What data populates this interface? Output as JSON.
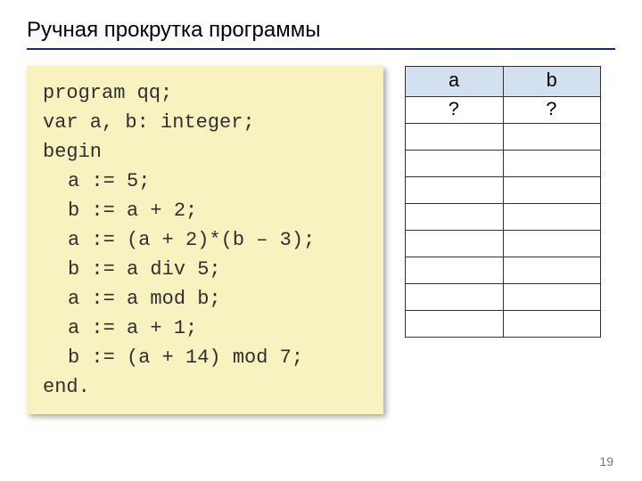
{
  "title": "Ручная прокрутка программы",
  "code": {
    "lines": [
      {
        "text": "program qq;",
        "indent": false
      },
      {
        "text": "var a, b: integer;",
        "indent": false
      },
      {
        "text": "begin",
        "indent": false
      },
      {
        "text": "a := 5;",
        "indent": true
      },
      {
        "text": "b := a + 2;",
        "indent": true
      },
      {
        "text": "a := (a + 2)*(b – 3);",
        "indent": true
      },
      {
        "text": "b := a div 5;",
        "indent": true
      },
      {
        "text": "a := a mod b;",
        "indent": true
      },
      {
        "text": "a := a + 1;",
        "indent": true
      },
      {
        "text": "b := (a + 14) mod 7;",
        "indent": true
      },
      {
        "text": "end.",
        "indent": false
      }
    ]
  },
  "trace": {
    "headers": [
      "a",
      "b"
    ],
    "rows": [
      [
        "?",
        "?"
      ],
      [
        "",
        ""
      ],
      [
        "",
        ""
      ],
      [
        "",
        ""
      ],
      [
        "",
        ""
      ],
      [
        "",
        ""
      ],
      [
        "",
        ""
      ],
      [
        "",
        ""
      ],
      [
        "",
        ""
      ]
    ]
  },
  "page_number": "19"
}
